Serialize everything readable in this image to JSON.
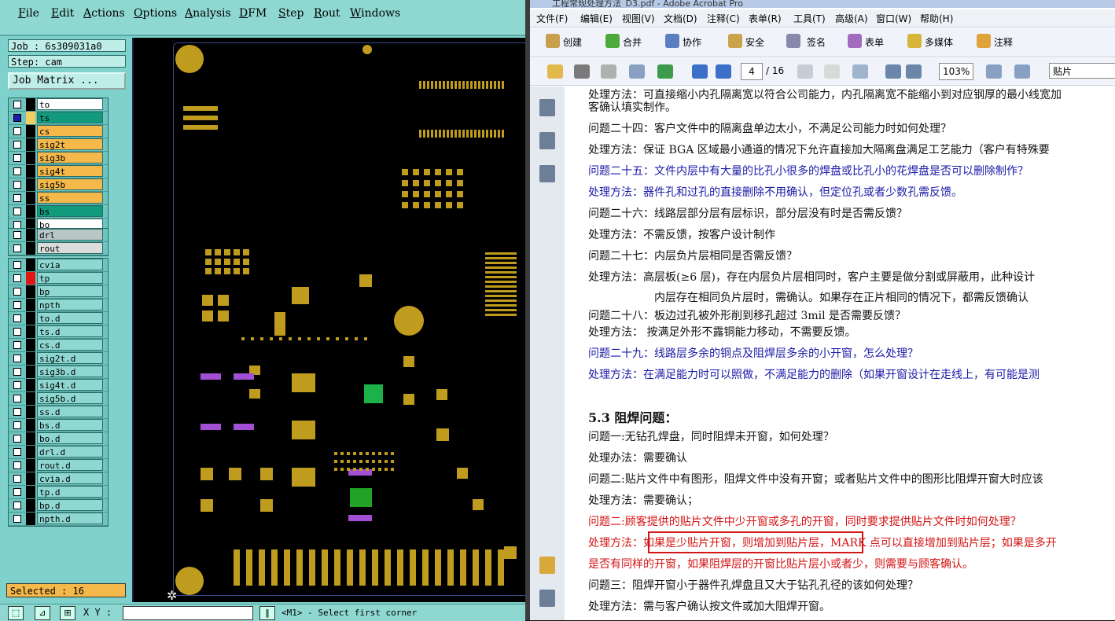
{
  "cam": {
    "menu": [
      "File",
      "Edit",
      "Actions",
      "Options",
      "Analysis",
      "DFM",
      "Step",
      "Rout",
      "Windows"
    ],
    "job": "Job : 6s309031a0",
    "step": "Step: cam",
    "job_matrix": "Job Matrix ...",
    "layers_board": [
      {
        "name": "to",
        "cls": "n-white"
      },
      {
        "name": "ts",
        "cls": "n-green"
      },
      {
        "name": "cs",
        "cls": "n-orange"
      },
      {
        "name": "sig2t",
        "cls": "n-orange"
      },
      {
        "name": "sig3b",
        "cls": "n-orange"
      },
      {
        "name": "sig4t",
        "cls": "n-orange"
      },
      {
        "name": "sig5b",
        "cls": "n-orange"
      },
      {
        "name": "ss",
        "cls": "n-orange"
      },
      {
        "name": "bs",
        "cls": "n-green"
      },
      {
        "name": "bo",
        "cls": "n-white"
      }
    ],
    "layers_drill": [
      {
        "name": "drl",
        "cls": "n-gray"
      },
      {
        "name": "rout",
        "cls": "n-lgray"
      }
    ],
    "layers_misc": [
      {
        "name": "cvia",
        "cls": "n-teal"
      },
      {
        "name": "tp",
        "cls": "n-teal"
      },
      {
        "name": "bp",
        "cls": "n-teal"
      },
      {
        "name": "npth",
        "cls": "n-teal"
      },
      {
        "name": "to.d",
        "cls": "n-teal"
      },
      {
        "name": "ts.d",
        "cls": "n-teal"
      },
      {
        "name": "cs.d",
        "cls": "n-teal"
      },
      {
        "name": "sig2t.d",
        "cls": "n-teal"
      },
      {
        "name": "sig3b.d",
        "cls": "n-teal"
      },
      {
        "name": "sig4t.d",
        "cls": "n-teal"
      },
      {
        "name": "sig5b.d",
        "cls": "n-teal"
      },
      {
        "name": "ss.d",
        "cls": "n-teal"
      },
      {
        "name": "bs.d",
        "cls": "n-teal"
      },
      {
        "name": "bo.d",
        "cls": "n-teal"
      },
      {
        "name": "drl.d",
        "cls": "n-teal"
      },
      {
        "name": "rout.d",
        "cls": "n-teal"
      },
      {
        "name": "cvia.d",
        "cls": "n-teal"
      },
      {
        "name": "tp.d",
        "cls": "n-teal"
      },
      {
        "name": "bp.d",
        "cls": "n-teal"
      },
      {
        "name": "npth.d",
        "cls": "n-teal"
      }
    ],
    "selected": "Selected : 16",
    "xy_label": "X Y :",
    "prompt": "<M1> - Select first corner"
  },
  "acro": {
    "title": "工程常规处理方法_D3.pdf - Adobe Acrobat Pro",
    "menu": [
      "文件(F)",
      "编辑(E)",
      "视图(V)",
      "文档(D)",
      "注释(C)",
      "表单(R)",
      "工具(T)",
      "高级(A)",
      "窗口(W)",
      "帮助(H)"
    ],
    "tools": [
      "创建",
      "合并",
      "协作",
      "安全",
      "签名",
      "表单",
      "多媒体",
      "注释"
    ],
    "page": "4",
    "page_total": "/ 16",
    "zoom": "103%",
    "search": "贴片",
    "lines": [
      {
        "t": "处理方法：可直接缩小内孔隔离宽以符合公司能力，内孔隔离宽不能缩小到对应钢厚的最小线宽加",
        "c": ""
      },
      {
        "t": "客确认填实制作。",
        "c": ""
      },
      {
        "t": "问题二十四：客户文件中的隔离盘单边太小，不满足公司能力时如何处理？",
        "c": ""
      },
      {
        "t": "处理方法：保证 BGA 区域最小通道的情况下允许直接加大隔离盘满足工艺能力（客户有特殊要",
        "c": ""
      },
      {
        "t": "问题二十五：文件内层中有大量的比孔小很多的焊盘或比孔小的花焊盘是否可以删除制作？",
        "c": "blue"
      },
      {
        "t": "处理方法：器件孔和过孔的直接删除不用确认，但定位孔或者少数孔需反馈。",
        "c": "blue"
      },
      {
        "t": "问题二十六：线路层部分层有层标识，部分层没有时是否需反馈？",
        "c": ""
      },
      {
        "t": "处理方法：不需反馈，按客户设计制作",
        "c": ""
      },
      {
        "t": "问题二十七：内层负片层相同是否需反馈？",
        "c": ""
      },
      {
        "t": "处理方法：高层板(≥6 层)，存在内层负片层相同时，客户主要是做分割或屏蔽用，此种设计",
        "c": ""
      },
      {
        "t": "内层存在相同负片层时，需确认。如果存在正片相同的情况下，都需反馈确认",
        "c": ""
      },
      {
        "t": "问题二十八：板边过孔被外形削到移孔超过 3mil 是否需要反馈？",
        "c": ""
      },
      {
        "t": "处理方法：  按满足外形不露铜能力移动，不需要反馈。",
        "c": ""
      },
      {
        "t": "问题二十九：线路层多余的铜点及阻焊层多余的小开窗，怎么处理？",
        "c": "blue"
      },
      {
        "t": "处理方法：在满足能力时可以照做，不满足能力的删除（如果开窗设计在走线上，有可能是测",
        "c": "blue"
      },
      {
        "t": "5.3 阻焊问题：",
        "c": "sec"
      },
      {
        "t": "问题一:无钻孔焊盘，同时阻焊未开窗，如何处理？",
        "c": ""
      },
      {
        "t": "处理办法：需要确认",
        "c": ""
      },
      {
        "t": "问题二:贴片文件中有图形，阻焊文件中没有开窗；或者贴片文件中的图形比阻焊开窗大时应该",
        "c": ""
      },
      {
        "t": "处理方法：需要确认；",
        "c": ""
      },
      {
        "t": "问题二:顾客提供的贴片文件中少开窗或多孔的开窗，同时要求提供贴片文件时如何处理？",
        "c": "red"
      },
      {
        "t": "处理方法：如果是少贴片开窗，则增加到贴片层，MARK 点可以直接增加到贴片层；如果是多开",
        "c": "red"
      },
      {
        "t": "是否有同样的开窗，如果阻焊层的开窗比贴片层小或者少，则需要与顾客确认。",
        "c": "red"
      },
      {
        "t": "问题三：阻焊开窗小于器件孔焊盘且又大于钻孔孔径的该如何处理？",
        "c": ""
      },
      {
        "t": "处理方法：需与客户确认按文件或加大阻焊开窗。",
        "c": ""
      }
    ]
  }
}
